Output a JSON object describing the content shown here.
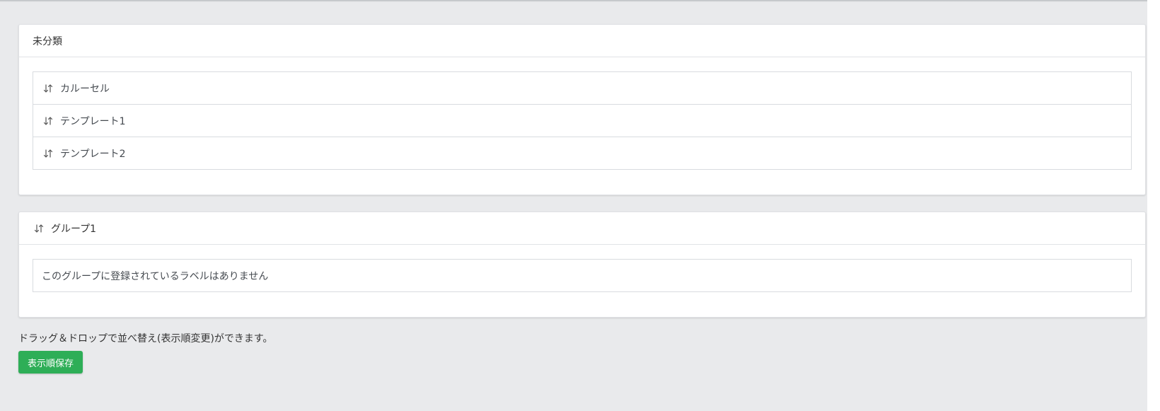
{
  "uncategorized": {
    "title": "未分類",
    "items": [
      {
        "label": "カルーセル",
        "icon": "sort-arrows-icon"
      },
      {
        "label": "テンプレート1",
        "icon": "sort-arrows-icon"
      },
      {
        "label": "テンプレート2",
        "icon": "sort-arrows-icon"
      }
    ]
  },
  "group1": {
    "title": "グループ1",
    "icon": "sort-arrows-icon",
    "empty_message": "このグループに登録されているラベルはありません"
  },
  "footer": {
    "note": "ドラッグ＆ドロップで並べ替え(表示順変更)ができます。",
    "save_label": "表示順保存"
  },
  "colors": {
    "background": "#e9eaec",
    "card": "#ffffff",
    "save_button": "#2eae57"
  }
}
